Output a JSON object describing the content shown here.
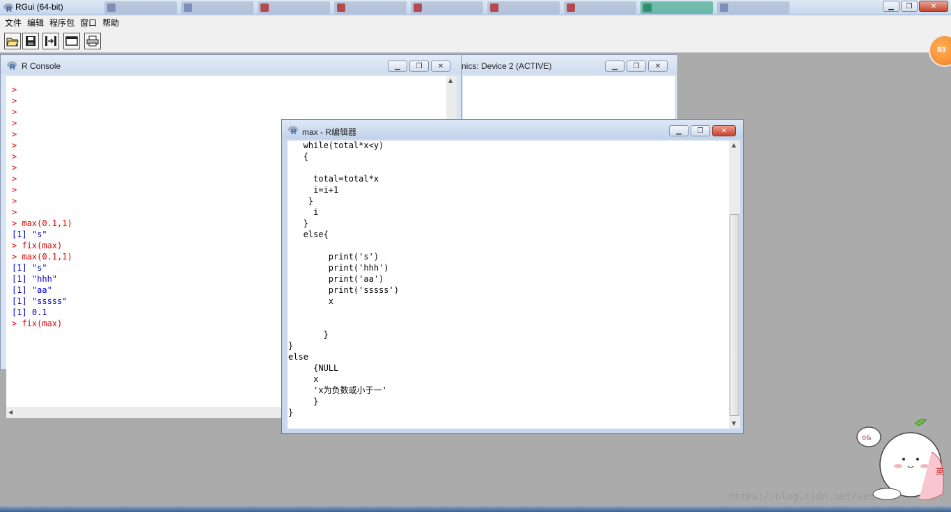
{
  "app": {
    "title": "RGui (64-bit)",
    "menu": [
      "文件",
      "编辑",
      "程序包",
      "窗口",
      "帮助"
    ],
    "toolbar": [
      "open-script-icon",
      "save-icon",
      "load-workspace-icon",
      "console-icon",
      "print-icon"
    ],
    "badge": "83"
  },
  "console": {
    "title": "R Console",
    "lines": [
      {
        "text": ">",
        "kind": "red"
      },
      {
        "text": ">",
        "kind": "red"
      },
      {
        "text": ">",
        "kind": "red"
      },
      {
        "text": ">",
        "kind": "red"
      },
      {
        "text": ">",
        "kind": "red"
      },
      {
        "text": ">",
        "kind": "red"
      },
      {
        "text": ">",
        "kind": "red"
      },
      {
        "text": ">",
        "kind": "red"
      },
      {
        "text": ">",
        "kind": "red"
      },
      {
        "text": ">",
        "kind": "red"
      },
      {
        "text": ">",
        "kind": "red"
      },
      {
        "text": ">",
        "kind": "red"
      },
      {
        "text": "> max(0.1,1)",
        "kind": "red"
      },
      {
        "text": "[1] \"s\"",
        "kind": "blue"
      },
      {
        "text": "> fix(max)",
        "kind": "red"
      },
      {
        "text": "> max(0.1,1)",
        "kind": "red"
      },
      {
        "text": "[1] \"s\"",
        "kind": "blue"
      },
      {
        "text": "[1] \"hhh\"",
        "kind": "blue"
      },
      {
        "text": "[1] \"aa\"",
        "kind": "blue"
      },
      {
        "text": "[1] \"sssss\"",
        "kind": "blue"
      },
      {
        "text": "[1] 0.1",
        "kind": "blue"
      },
      {
        "text": "> fix(max)",
        "kind": "red"
      }
    ]
  },
  "graphics": {
    "title": "nics: Device 2 (ACTIVE)"
  },
  "editor": {
    "title": "max - R编辑器",
    "lines": [
      "   while(total*x<y)",
      "   {",
      "",
      "     total=total*x",
      "     i=i+1",
      "    }",
      "     i",
      "   }",
      "   else{",
      "",
      "        print('s')",
      "        print('hhh')",
      "        print('aa')",
      "        print('sssss')",
      "        x",
      "",
      "",
      "       }",
      "}",
      "else",
      "     {NULL",
      "     x",
      "     'x为负数或小于一'",
      "     }",
      "}"
    ]
  },
  "watermark": "https://blog.csdn.net/weixin_"
}
